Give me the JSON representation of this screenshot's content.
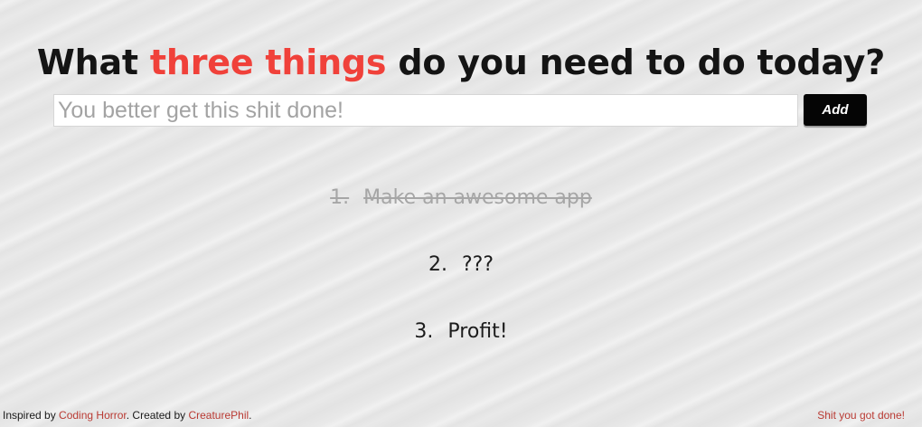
{
  "headline": {
    "prefix": "What ",
    "accent": "three things",
    "suffix": " do you need to do today?",
    "accent_color": "#f0413a"
  },
  "add_form": {
    "placeholder": "You better get this shit done!",
    "value": "",
    "button_label": "Add"
  },
  "tasks": [
    {
      "number": "1.",
      "text": "Make an awesome app",
      "done": true
    },
    {
      "number": "2.",
      "text": "???",
      "done": false
    },
    {
      "number": "3.",
      "text": "Profit!",
      "done": false
    }
  ],
  "footer": {
    "inspired_prefix": "Inspired by ",
    "inspired_link": "Coding Horror",
    "created_prefix": ". Created by ",
    "created_link": "CreaturePhil",
    "created_suffix": ".",
    "right_link": "Shit you got done!",
    "link_color": "#b93a33"
  }
}
